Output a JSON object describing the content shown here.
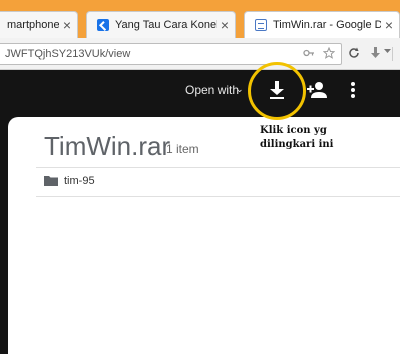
{
  "tabs": [
    {
      "label": "martphone: C",
      "close": "×",
      "icon": "doc-icon"
    },
    {
      "label": "Yang Tau Cara Koneksi Wi...",
      "close": "×",
      "icon": "site-icon"
    },
    {
      "label": "TimWin.rar - Google Drive",
      "close": "×",
      "icon": "drive-doc-icon"
    }
  ],
  "address": {
    "url": "JWFTQjhSY213VUk/view"
  },
  "viewer": {
    "open_with": "Open with",
    "open_chevron": "⌄"
  },
  "folder": {
    "title": "TimWin.rar",
    "count": "1 item",
    "items": [
      {
        "name": "tim-95"
      }
    ]
  },
  "annotation": {
    "line1": "Klik icon yg",
    "line2": "dilingkari ini",
    "color": "#f2c200"
  },
  "colors": {
    "tab_strip": "#f4a13a",
    "toolbar": "#141414"
  }
}
